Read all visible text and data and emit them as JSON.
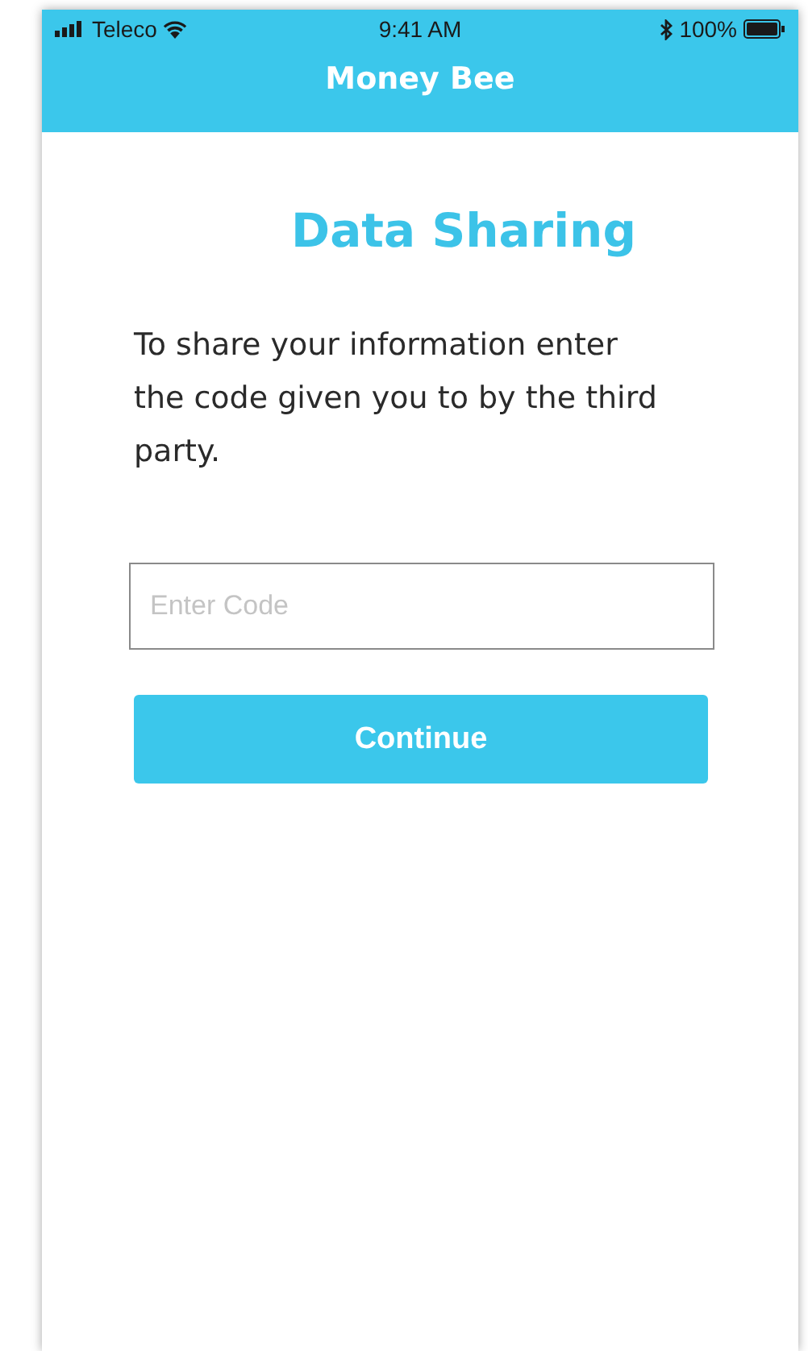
{
  "status_bar": {
    "carrier": "Teleco",
    "time": "9:41 AM",
    "battery": "100%"
  },
  "nav_bar": {
    "title": "Money Bee"
  },
  "heading": "Data Sharing",
  "instructions": "To share your information enter the code given you to by the third party.",
  "code_field": {
    "placeholder": "Enter Code"
  },
  "continue_button": "Continue"
}
